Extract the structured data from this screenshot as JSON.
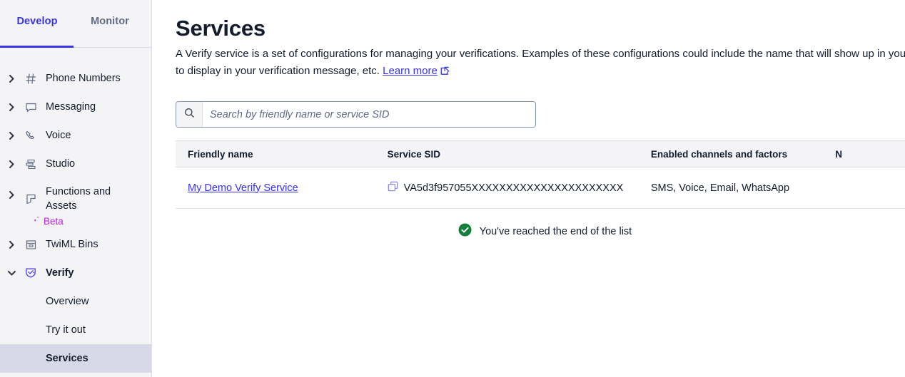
{
  "sidebar": {
    "tabs": [
      {
        "label": "Develop",
        "active": true
      },
      {
        "label": "Monitor",
        "active": false
      }
    ],
    "items": [
      {
        "label": "Phone Numbers",
        "icon": "hash-icon",
        "expanded": false
      },
      {
        "label": "Messaging",
        "icon": "chat-bubble-icon",
        "expanded": false
      },
      {
        "label": "Voice",
        "icon": "phone-icon",
        "expanded": false
      },
      {
        "label": "Studio",
        "icon": "studio-flow-icon",
        "expanded": false
      },
      {
        "label": "Functions and Assets",
        "icon": "functions-icon",
        "expanded": false,
        "badge": "Beta"
      },
      {
        "label": "TwiML Bins",
        "icon": "twiml-bin-icon",
        "expanded": false
      },
      {
        "label": "Verify",
        "icon": "verify-shield-icon",
        "expanded": true
      }
    ],
    "verify_children": [
      {
        "label": "Overview",
        "selected": false
      },
      {
        "label": "Try it out",
        "selected": false
      },
      {
        "label": "Services",
        "selected": true
      }
    ],
    "beta_badge": "Beta"
  },
  "main": {
    "title": "Services",
    "description_line1": "A Verify service is a set of configurations for managing your verifications. Examples of these configurations could include the name that will show up in your v",
    "description_line2": "to display in your verification message, etc.",
    "learn_more": "Learn more",
    "search": {
      "placeholder": "Search by friendly name or service SID",
      "value": "",
      "icon": "search-icon"
    },
    "table": {
      "columns": [
        "Friendly name",
        "Service SID",
        "Enabled channels and factors",
        "N"
      ],
      "rows": [
        {
          "friendly_name": "My Demo Verify Service",
          "service_sid": "VA5d3f957055XXXXXXXXXXXXXXXXXXXXXX",
          "copy_icon": "copy-icon",
          "channels": "SMS, Voice, Email, WhatsApp",
          "col4": ""
        }
      ]
    },
    "end_of_list": {
      "text": "You've reached the end of the list",
      "icon": "check-circle-icon"
    }
  },
  "colors": {
    "accent": "#3733e7",
    "sidebar_bg": "#f4f4f6",
    "selected_bg": "#d8d9e8",
    "beta": "#b520e0",
    "success": "#14803c",
    "text": "#121c2d",
    "muted": "#606b85",
    "border": "#e1e3ea"
  }
}
